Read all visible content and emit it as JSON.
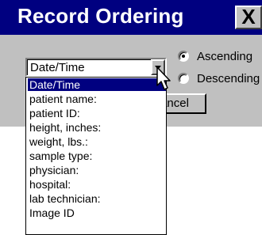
{
  "dialog": {
    "title": "Record Ordering",
    "close_label": "X"
  },
  "sort_field": {
    "value": "Date/Time",
    "options": [
      "Date/Time",
      "patient name:",
      "patient ID:",
      "height, inches:",
      "weight, lbs.:",
      "sample type:",
      "physician:",
      "hospital:",
      "lab technician:",
      "Image ID"
    ],
    "selected_index": 0
  },
  "order": {
    "ascending_label": "Ascending",
    "descending_label": "Descending",
    "selected": "Ascending"
  },
  "buttons": {
    "cancel_label": "ancel"
  },
  "colors": {
    "titlebar": "#000080",
    "face": "#c0c0c0",
    "highlight": "#000080"
  }
}
